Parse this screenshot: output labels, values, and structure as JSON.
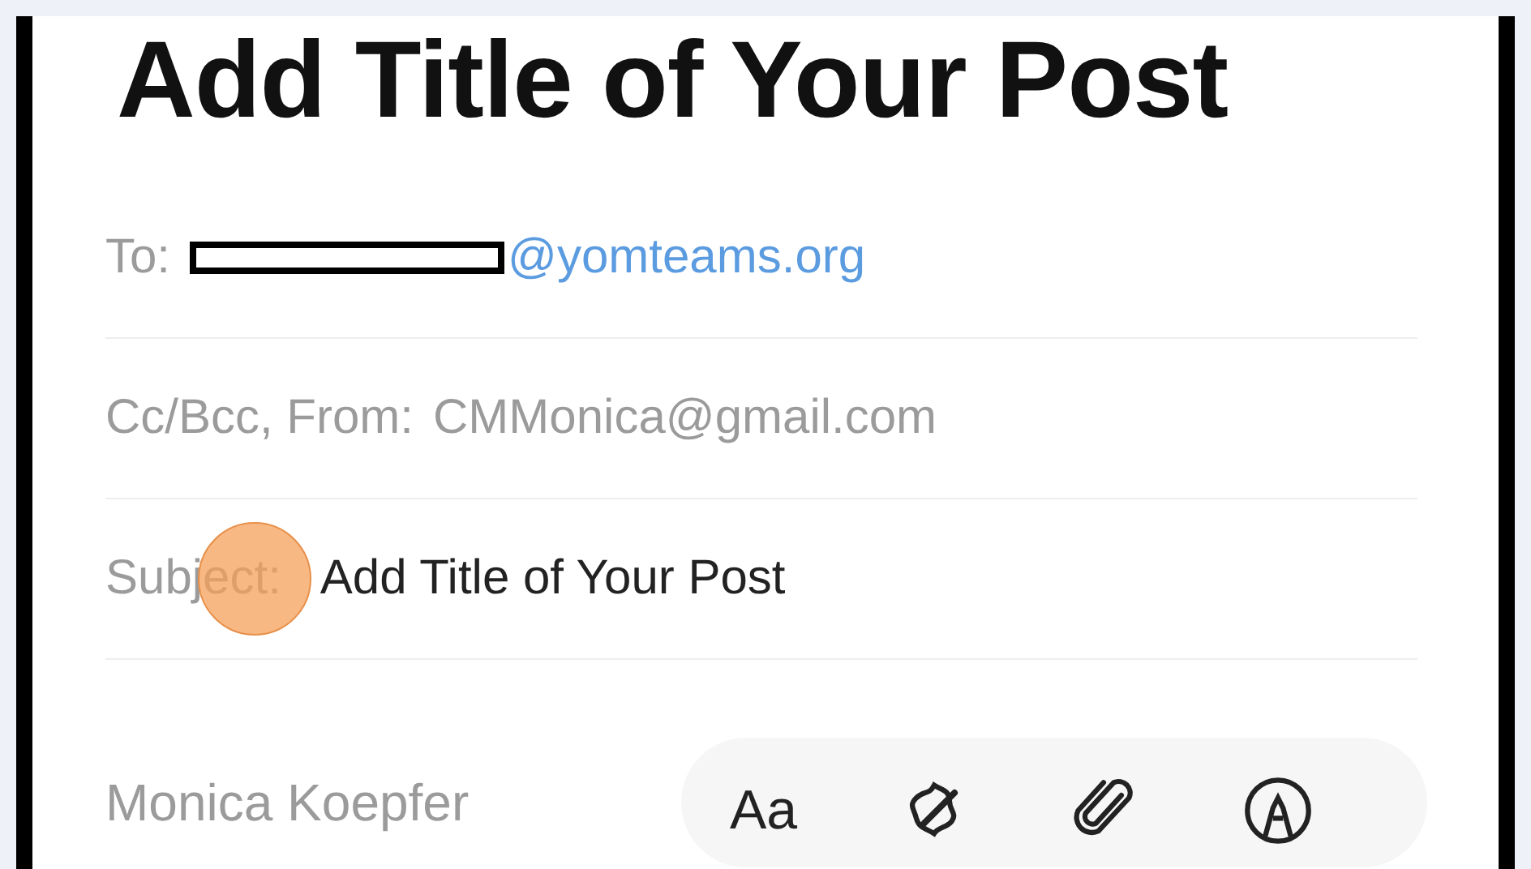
{
  "title": "Add Title of Your Post",
  "fields": [
    {
      "kind": "to",
      "label": "To:",
      "value": "@yomteams.org",
      "redacted": true
    },
    {
      "kind": "from",
      "label": "Cc/Bcc, From:",
      "value": "CMMonica@gmail.com",
      "redacted": false
    },
    {
      "kind": "subject",
      "label": "Subject:",
      "value": "Add Title of Your Post",
      "redacted": false
    }
  ],
  "signature": "Monica Koepfer",
  "toolbar": [
    {
      "kind": "text",
      "label": "Aa"
    },
    {
      "kind": "writing-tools"
    },
    {
      "kind": "attach"
    },
    {
      "kind": "markup"
    }
  ]
}
